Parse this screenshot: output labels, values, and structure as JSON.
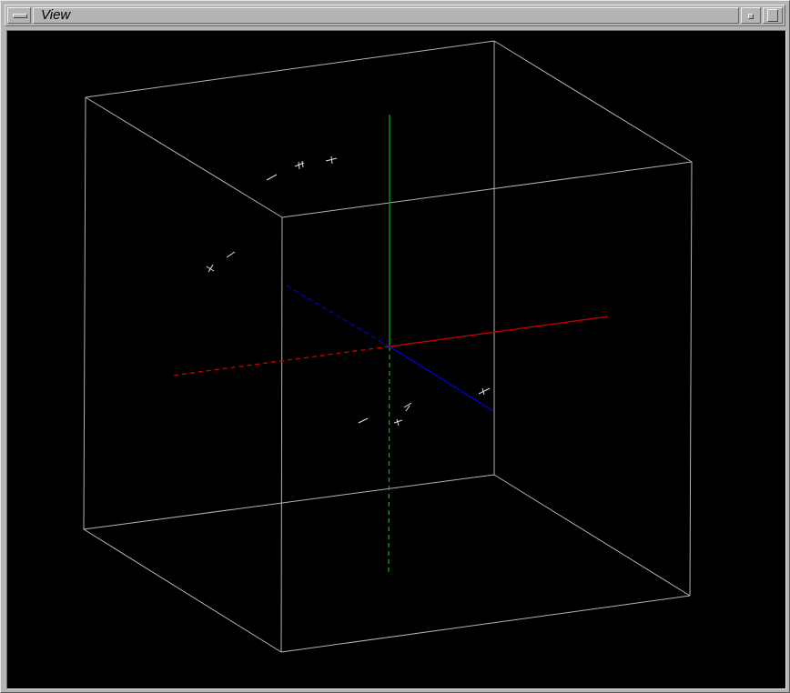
{
  "window": {
    "title": "View"
  },
  "icons": {
    "window_menu": "window-menu-icon",
    "minimize": "minimize-icon",
    "maximize": "maximize-icon"
  },
  "colors": {
    "background": "#000000",
    "bounding_box": "#b4b4b4",
    "axis_x": "#d00000",
    "axis_y": "#00b000",
    "axis_z": "#0000d0",
    "markers": "#e0e0e0"
  },
  "scene": {
    "type": "3d-viewport",
    "bounding_box": true,
    "axes": [
      "x",
      "y",
      "z"
    ],
    "marker_count": 7
  }
}
